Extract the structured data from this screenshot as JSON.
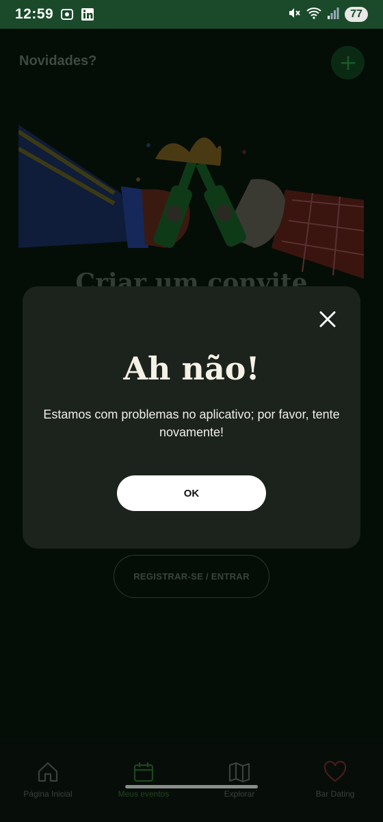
{
  "status_bar": {
    "time": "12:59",
    "battery": "77",
    "icons": [
      "screenshot-icon",
      "linkedin-icon",
      "mute-icon",
      "wifi-icon",
      "signal-icon"
    ]
  },
  "page": {
    "header": "Novidades?",
    "add_icon": "plus-icon",
    "hero_title": "Criar um convite",
    "register_button": "REGISTRAR-SE / ENTRAR"
  },
  "modal": {
    "title": "Ah não!",
    "message": "Estamos com problemas no aplicativo; por favor, tente novamente!",
    "ok_label": "OK",
    "close_icon": "close-icon"
  },
  "bottom_nav": {
    "items": [
      {
        "label": "Página Inicial",
        "icon": "home-icon"
      },
      {
        "label": "Meus eventos",
        "icon": "calendar-icon",
        "active": true
      },
      {
        "label": "Explorar",
        "icon": "map-icon"
      },
      {
        "label": "Bar Dating",
        "icon": "heart-icon"
      }
    ]
  },
  "colors": {
    "status_bar": "#1a4a2a",
    "modal_bg": "#1b231c",
    "background": "#050d07",
    "accent_green": "#0b2a14"
  }
}
